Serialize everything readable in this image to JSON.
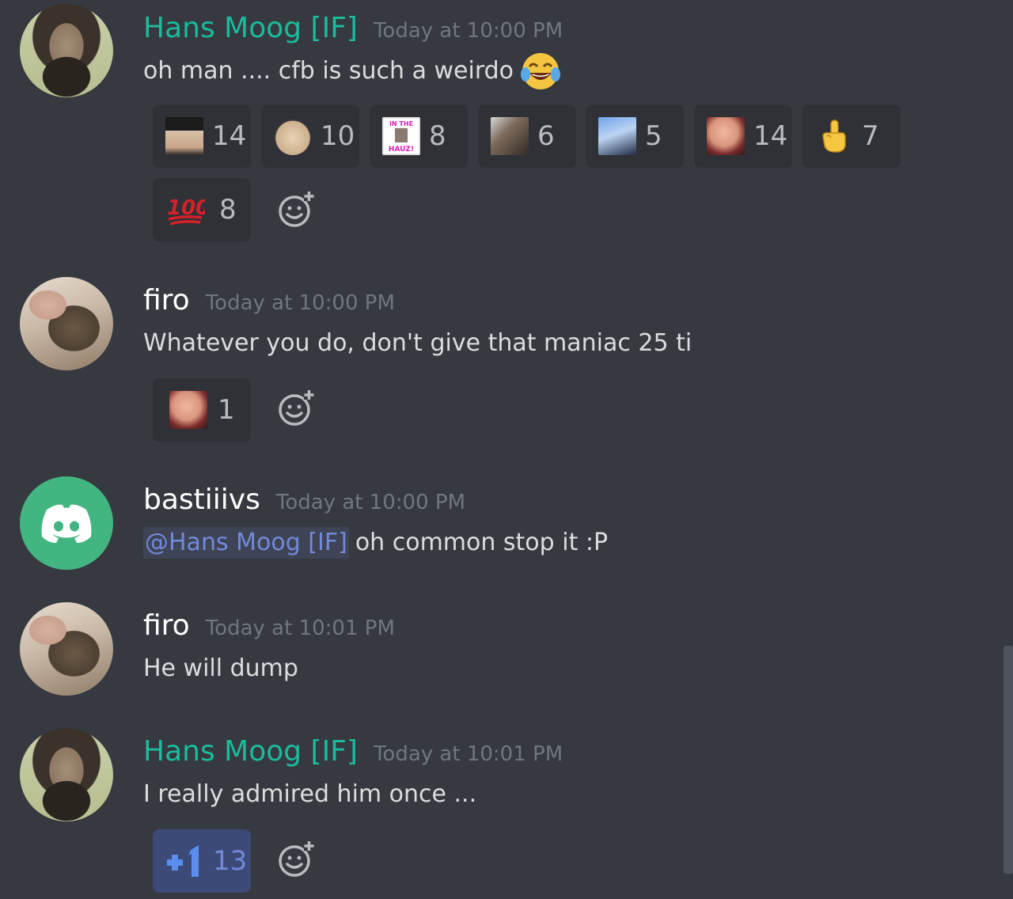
{
  "messages": [
    {
      "author": "Hans Moog [IF]",
      "timestamp": "Today at 10:00 PM",
      "text": "oh man .... cfb is such a weirdo",
      "emoji": "face-with-tears-of-joy-icon",
      "reactions": [
        {
          "emoji": "top-hat-kid-emoji",
          "count": "14"
        },
        {
          "emoji": "troll-face-emoji",
          "count": "10"
        },
        {
          "emoji": "in-the-hauz-emoji",
          "count": "8"
        },
        {
          "emoji": "thinking-man-emoji",
          "count": "6"
        },
        {
          "emoji": "trump-pointing-emoji",
          "count": "5"
        },
        {
          "emoji": "laughing-bald-man-emoji",
          "count": "14"
        },
        {
          "emoji": "point-up-hand-emoji",
          "count": "7"
        },
        {
          "emoji": "hundred-points-emoji",
          "count": "8"
        }
      ]
    },
    {
      "author": "firo",
      "timestamp": "Today at 10:00 PM",
      "text": "Whatever you do, don't give that maniac 25 ti",
      "reactions": [
        {
          "emoji": "laughing-bald-man-emoji",
          "count": "1"
        }
      ]
    },
    {
      "author": "bastiiivs",
      "timestamp": "Today at 10:00 PM",
      "mention": "@Hans Moog [IF]",
      "text": "oh common stop it :P"
    },
    {
      "author": "firo",
      "timestamp": "Today at 10:01 PM",
      "text": "He will dump"
    },
    {
      "author": "Hans Moog [IF]",
      "timestamp": "Today at 10:01 PM",
      "text": "I really admired him once ...",
      "reactions": [
        {
          "emoji": "plus-one-emoji",
          "count": "13",
          "active": true
        }
      ]
    }
  ],
  "emoji_text": {
    "hauz": "IN THE HAUZ!",
    "hundred": "100"
  },
  "colors": {
    "background": "#36393f",
    "author_role_color": "#1abc9c",
    "mention_color": "#7289da",
    "discord_green": "#43b581"
  }
}
